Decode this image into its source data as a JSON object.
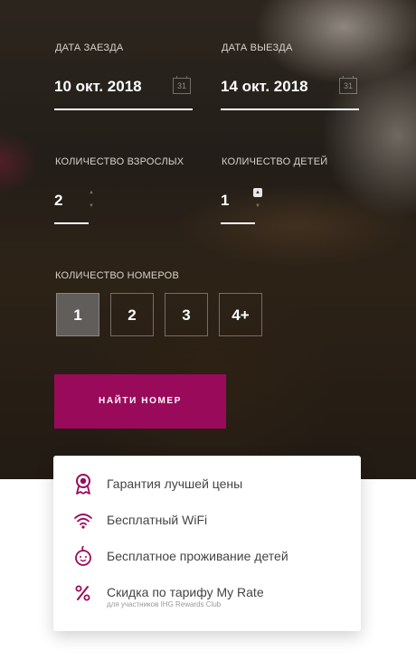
{
  "booking": {
    "checkin_label": "ДАТА ЗАЕЗДА",
    "checkin_value": "10 окт. 2018",
    "checkout_label": "ДАТА ВЫЕЗДА",
    "checkout_value": "14 окт. 2018",
    "calendar_icon_text": "31",
    "adults_label": "КОЛИЧЕСТВО ВЗРОСЛЫХ",
    "adults_value": "2",
    "children_label": "КОЛИЧЕСТВО ДЕТЕЙ",
    "children_value": "1",
    "rooms_label": "КОЛИЧЕСТВО НОМЕРОВ",
    "rooms_options": [
      "1",
      "2",
      "3",
      "4+"
    ],
    "rooms_selected": "1",
    "search_label": "НАЙТИ НОМЕР"
  },
  "features": [
    {
      "icon": "award-medal-icon",
      "text": "Гарантия лучшей цены"
    },
    {
      "icon": "wifi-icon",
      "text": "Бесплатный WiFi"
    },
    {
      "icon": "baby-icon",
      "text": "Бесплатное проживание детей"
    },
    {
      "icon": "percent-icon",
      "text": "Скидка по тарифу My Rate",
      "subtext": "для участников IHG Rewards Club"
    }
  ],
  "colors": {
    "accent": "#9a0a5b",
    "card_bg": "#ffffff",
    "feature_text": "#444444"
  }
}
